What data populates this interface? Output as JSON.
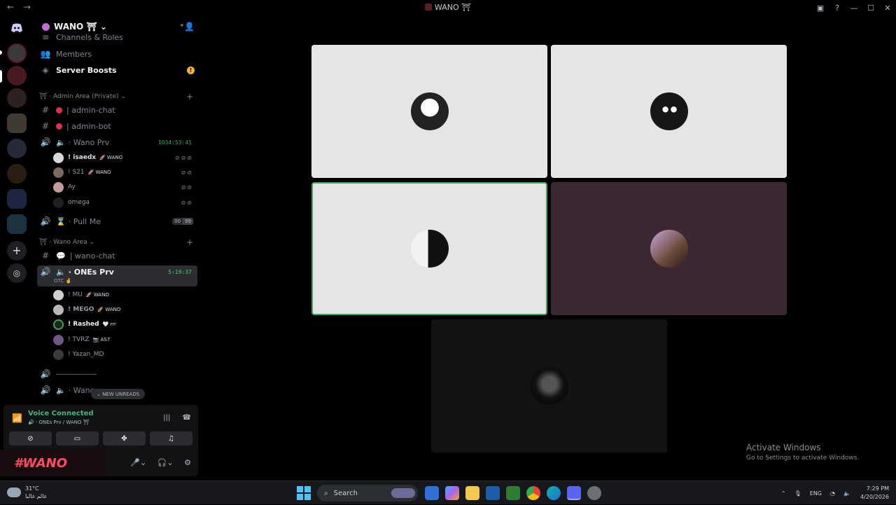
{
  "window": {
    "title": "WANO ⛩",
    "back": "←",
    "forward": "→"
  },
  "server": {
    "name": "WANO ⛩ ⌄"
  },
  "top_items": [
    {
      "label": "Channels & Roles"
    },
    {
      "label": "Members"
    },
    {
      "label": "Server Boosts"
    }
  ],
  "categories": {
    "admin": "⛩ · Admin Area (Private) ⌄",
    "wano": "⛩ · Wano Area ⌄"
  },
  "channels": {
    "admin_chat": "| admin-chat",
    "admin_bot": "| admin-bot",
    "wano_prv": "· Wano Prv",
    "wano_prv_timer": "1034:53:41",
    "pull_me": "· Pull Me",
    "pull_me_a": "00",
    "pull_me_b": "99",
    "wano_chat": "| wano-chat",
    "ones_prv": "· ONEs Prv",
    "ones_prv_timer": "5:19:37",
    "ones_prv_status": "OTC 🤞",
    "divider": "────────────",
    "wano_partial": "· Wano"
  },
  "wano_prv_users": [
    {
      "name": "! isaedx",
      "tag": "🚀 WANO"
    },
    {
      "name": "! S21",
      "tag": "🚀 WANO"
    },
    {
      "name": "Ay",
      "tag": ""
    },
    {
      "name": "omega",
      "tag": ""
    }
  ],
  "ones_prv_users": [
    {
      "name": "! MU",
      "tag": "🚀 WANO"
    },
    {
      "name": "! MEGO",
      "tag": "🚀 WANO"
    },
    {
      "name": "! Rashed",
      "tag": "🤍 rrr"
    },
    {
      "name": "! TVRZ",
      "tag": "📷 AS7"
    },
    {
      "name": "! Yazan_MD",
      "tag": ""
    }
  ],
  "new_unreads": "⌄  NEW UNREADS",
  "voice": {
    "status": "Voice Connected",
    "location": "🔊 · ONEs Prv / WANO ⛩"
  },
  "user_logo": "#WANO",
  "watermark": {
    "line1": "Activate Windows",
    "line2": "Go to Settings to activate Windows."
  },
  "taskbar": {
    "weather_temp": "31°C",
    "weather_desc": "عالم غالبا",
    "search": "Search",
    "lang": "ENG",
    "time": "7:29 PM",
    "date": "4/20/2026"
  },
  "colors": {
    "voice_green": "#43b581",
    "mention_red": "#e0304f",
    "speaking_border": "#3ba55d",
    "brand_red": "#ff4b63"
  }
}
